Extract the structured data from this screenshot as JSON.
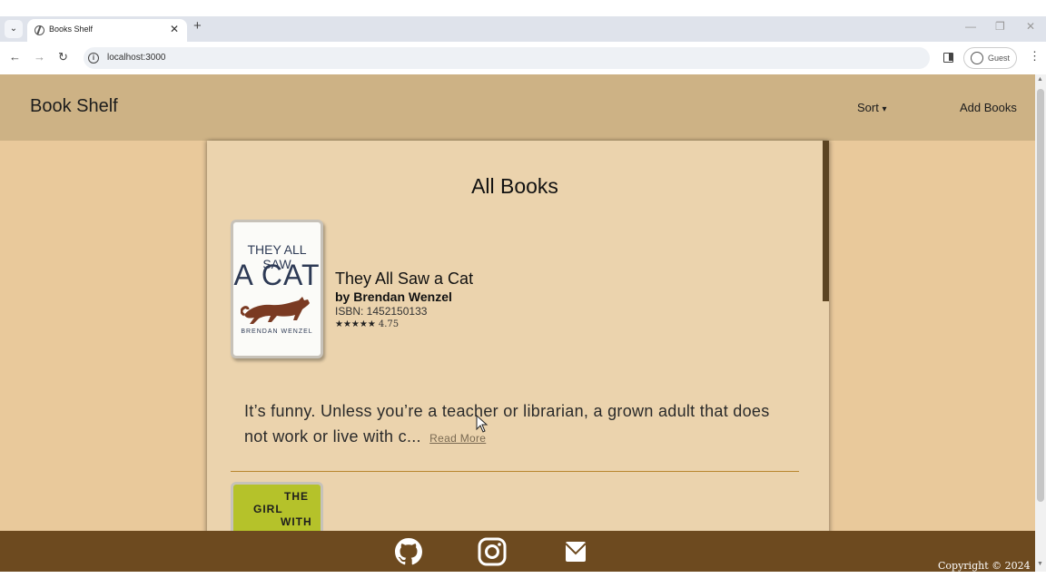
{
  "browser": {
    "tab_title": "Books Shelf",
    "url": "localhost:3000",
    "profile_label": "Guest"
  },
  "header": {
    "brand": "Book Shelf",
    "sort_label": "Sort",
    "sort_caret": "▾",
    "add_books_label": "Add Books"
  },
  "main": {
    "page_title": "All Books",
    "books": [
      {
        "cover_line1": "THEY ALL SAW",
        "cover_line2": "A CAT",
        "cover_author": "BRENDAN WENZEL",
        "title": "They All Saw a Cat",
        "author": "by Brendan Wenzel",
        "isbn": "ISBN: 1452150133",
        "stars": "★★★★★",
        "rating": "4.75",
        "description": "It’s funny. Unless you’re a teacher or librarian, a grown adult that does not work or live with c...",
        "read_more": "Read More"
      },
      {
        "cover_line1": "THE",
        "cover_line2": "GIRL",
        "cover_line3": "WITH"
      }
    ]
  },
  "footer": {
    "icons": [
      "github-icon",
      "instagram-icon",
      "mail-icon"
    ],
    "copyright": "Copyright © 2024"
  },
  "colors": {
    "header_bg": "#cdb285",
    "page_bg": "#e9c99b",
    "panel_bg": "#ebd3ad",
    "footer_bg": "#6d4a1f",
    "divider": "#b8862f"
  }
}
